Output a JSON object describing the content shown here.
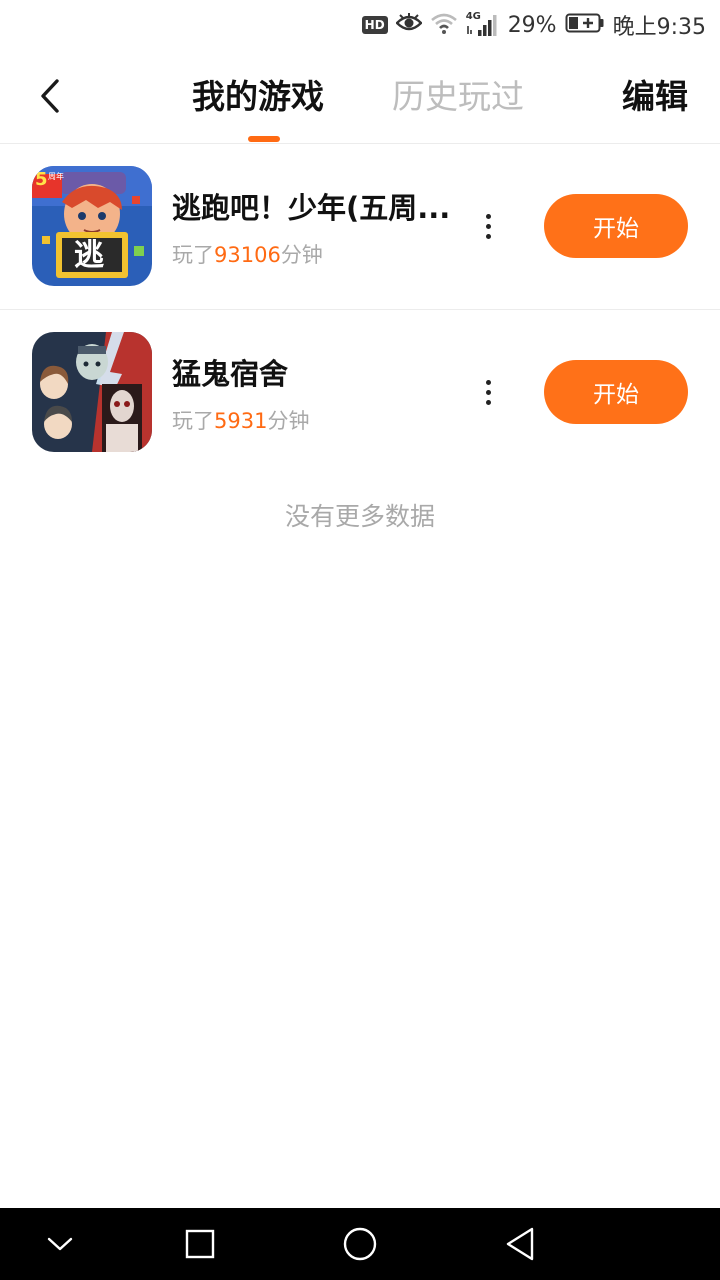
{
  "status_bar": {
    "hd_label": "HD",
    "network_label": "4G",
    "battery": "29%",
    "time": "晚上9:35",
    "icons": [
      "hd-icon",
      "eye-icon",
      "wifi-icon",
      "signal-icon",
      "battery-icon"
    ]
  },
  "header": {
    "back_icon": "chevron-left-icon",
    "tabs": [
      {
        "label": "我的游戏",
        "active": true
      },
      {
        "label": "历史玩过",
        "active": false
      }
    ],
    "edit_label": "编辑",
    "accent_color": "#ff6a13"
  },
  "games": [
    {
      "name": "逃跑吧！少年(五周...",
      "play_prefix": "玩了",
      "minutes": "93106",
      "play_suffix": "分钟",
      "button_label": "开始",
      "icon_badge": "5",
      "icon_badge_sub": "周年",
      "icon_char": "逃"
    },
    {
      "name": "猛鬼宿舍",
      "play_prefix": "玩了",
      "minutes": "5931",
      "play_suffix": "分钟",
      "button_label": "开始"
    }
  ],
  "list_footer": "没有更多数据",
  "nav_bar": {
    "buttons": [
      "collapse-icon",
      "recents-icon",
      "home-icon",
      "back-icon"
    ]
  },
  "colors": {
    "accent": "#ff6a13",
    "button": "#ff7118",
    "muted_text": "#a9a9a9"
  }
}
